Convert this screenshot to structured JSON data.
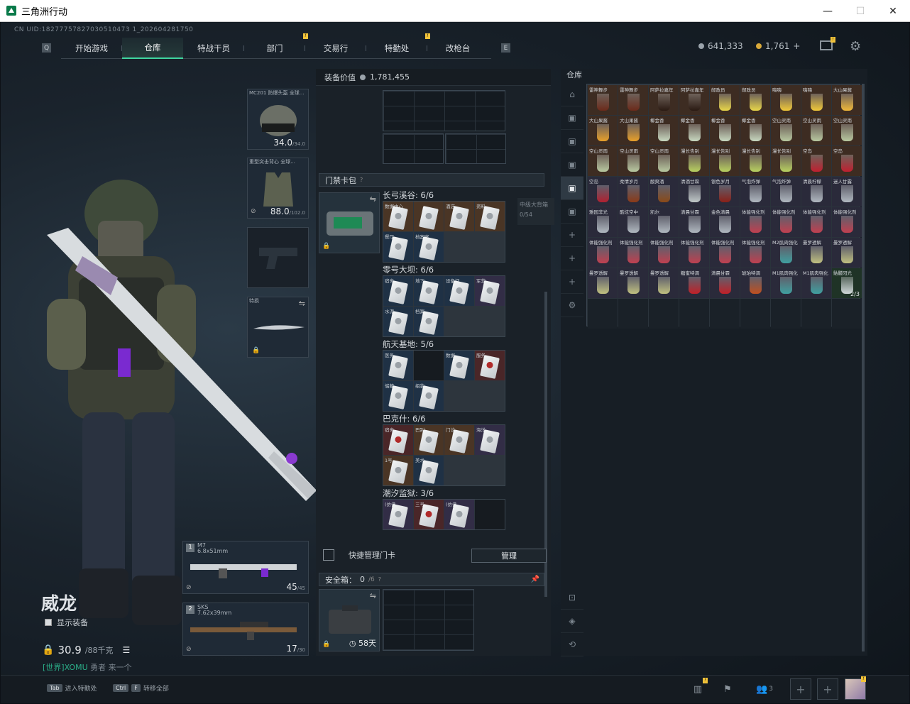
{
  "window": {
    "title": "三角洲行动",
    "minimize": "—",
    "maximize": "☐",
    "close": "✕"
  },
  "uid": "CN UID:18277757827030510473 1_202604281750",
  "nav": {
    "tabs": [
      {
        "label": "开始游戏"
      },
      {
        "label": "仓库"
      },
      {
        "label": "特战干员"
      },
      {
        "label": "部门"
      },
      {
        "label": "交易行"
      },
      {
        "label": "特勤处"
      },
      {
        "label": "改枪台"
      }
    ],
    "active": "仓库",
    "left_key": "Q",
    "right_key": "E",
    "badge": "!"
  },
  "currency": {
    "silver": "641,333",
    "gold": "1,761",
    "gold_plus": "+"
  },
  "operator": {
    "name": "威龙",
    "show_equipment": "显示装备",
    "weight": "30.9",
    "weight_max": "/88千克",
    "world_channel": "[世界]XOMU",
    "world_msg": "勇者 来一个"
  },
  "equip": {
    "helmet": {
      "label": "MC201 防爆头盔 全球...",
      "dur": "34.0",
      "max": "/34.0"
    },
    "armor": {
      "label": "重型突击背心 全球...",
      "dur": "88.0",
      "max": "/102.0"
    },
    "melee": {
      "label": "特损"
    },
    "weapon1": {
      "slot": "1",
      "name": "M7",
      "caliber": "6.8x51mm",
      "ammo": "45",
      "max": "/45"
    },
    "weapon2": {
      "slot": "2",
      "name": "SKS",
      "caliber": "7.62x39mm",
      "ammo": "17",
      "max": "/30"
    }
  },
  "middle": {
    "value_label": "装备价值",
    "value": "1,781,455",
    "keycard_title": "门禁卡包",
    "quick_manage": "快捷管理门卡",
    "manage_btn": "管理",
    "safebox": "安全箱：",
    "safebox_count": "0",
    "safebox_max": "/6",
    "safebox_days": "58天",
    "hint_q": "?",
    "tooltip": {
      "name": "中级大背箱",
      "cap": "0/54"
    },
    "groups": [
      {
        "title": "长弓溪谷: 6/6",
        "cards": [
          {
            "n": "数据中心",
            "c": "o"
          },
          {
            "n": "",
            "c": "o"
          },
          {
            "n": "酒店",
            "c": "o"
          },
          {
            "n": "资料",
            "c": "o"
          },
          {
            "n": "餐厅",
            "c": "b"
          },
          {
            "n": "档案室",
            "c": "b"
          }
        ]
      },
      {
        "title": "零号大坝: 6/6",
        "cards": [
          {
            "n": "宿舍",
            "c": "b"
          },
          {
            "n": "地下",
            "c": "b"
          },
          {
            "n": "设备间",
            "c": "b"
          },
          {
            "n": "军营",
            "c": "p"
          },
          {
            "n": "水泥",
            "c": "b"
          },
          {
            "n": "档案",
            "c": "b"
          }
        ]
      },
      {
        "title": "航天基地: 5/6",
        "cards": [
          {
            "n": "医务",
            "c": "b"
          },
          {
            "n": "",
            "c": "e"
          },
          {
            "n": "数据",
            "c": "b"
          },
          {
            "n": "服务",
            "c": "r"
          },
          {
            "n": "储藏",
            "c": "b"
          },
          {
            "n": "组装",
            "c": "b"
          }
        ]
      },
      {
        "title": "巴克什: 6/6",
        "cards": [
          {
            "n": "宿舍",
            "c": "r"
          },
          {
            "n": "巴别",
            "c": "o"
          },
          {
            "n": "门诊",
            "c": "o"
          },
          {
            "n": "海洋",
            "c": "p"
          },
          {
            "n": "1号",
            "c": "o"
          },
          {
            "n": "美术",
            "c": "b"
          }
        ]
      },
      {
        "title": "潮汐监狱: 3/6",
        "cards": [
          {
            "n": "(仿佛",
            "c": "p"
          },
          {
            "n": "三号",
            "c": "r"
          },
          {
            "n": "(仿佛",
            "c": "p"
          },
          {
            "n": "",
            "c": "e"
          }
        ]
      }
    ]
  },
  "stash": {
    "title": "仓库",
    "items": [
      {
        "n": "雷神舞步",
        "c": "o",
        "g": "#6b2a1a"
      },
      {
        "n": "雷神舞步",
        "c": "o",
        "g": "#6b2a1a"
      },
      {
        "n": "阿萨拉嘉年",
        "c": "o",
        "g": "#2a1a12"
      },
      {
        "n": "阿萨拉嘉年",
        "c": "o",
        "g": "#2a1a12"
      },
      {
        "n": "邮政员",
        "c": "o",
        "g": "#e8d64a"
      },
      {
        "n": "邮政员",
        "c": "o",
        "g": "#e8d64a"
      },
      {
        "n": "嗨嗨",
        "c": "o",
        "g": "#f0c83a"
      },
      {
        "n": "嗨嗨",
        "c": "o",
        "g": "#f0c83a"
      },
      {
        "n": "大山果酱",
        "c": "o",
        "g": "#f0b83a"
      },
      {
        "n": "大山果酱",
        "c": "o",
        "g": "#e8a02a"
      },
      {
        "n": "大山果酱",
        "c": "o",
        "g": "#e8a02a"
      },
      {
        "n": "椰金香",
        "c": "o",
        "g": "#c8d8c0"
      },
      {
        "n": "椰金香",
        "c": "o",
        "g": "#c8d8c0"
      },
      {
        "n": "椰金香",
        "c": "o",
        "g": "#c8d8c0"
      },
      {
        "n": "椰金香",
        "c": "o",
        "g": "#c8d8c0"
      },
      {
        "n": "空山灵雨",
        "c": "o",
        "g": "#b8c8a0"
      },
      {
        "n": "空山灵雨",
        "c": "o",
        "g": "#b8c8a0"
      },
      {
        "n": "空山灵雨",
        "c": "o",
        "g": "#b8c8a0"
      },
      {
        "n": "空山灵雨",
        "c": "o",
        "g": "#b8c8a0"
      },
      {
        "n": "空山灵雨",
        "c": "o",
        "g": "#b8c8a0"
      },
      {
        "n": "空山灵雨",
        "c": "o",
        "g": "#b8c8a0"
      },
      {
        "n": "漫长告别",
        "c": "o",
        "g": "#b8d060"
      },
      {
        "n": "漫长告别",
        "c": "o",
        "g": "#b8d060"
      },
      {
        "n": "漫长告别",
        "c": "o",
        "g": "#b8d060"
      },
      {
        "n": "漫长告别",
        "c": "o",
        "g": "#b8d060"
      },
      {
        "n": "空岛",
        "c": "o",
        "g": "#c02030"
      },
      {
        "n": "空岛",
        "c": "o",
        "g": "#c02030"
      },
      {
        "n": "空岛",
        "c": "p",
        "g": "#b02030"
      },
      {
        "n": "柔情岁月",
        "c": "p",
        "g": "#8a3a18"
      },
      {
        "n": "酸爽酒",
        "c": "p",
        "g": "#8a4a18"
      },
      {
        "n": "清酒甘霖",
        "c": "p",
        "g": "#c0c8c8"
      },
      {
        "n": "银色岁月",
        "c": "p",
        "g": "#8a2018"
      },
      {
        "n": "气泡炸弹",
        "c": "p",
        "g": "#b0b8c0"
      },
      {
        "n": "气泡炸弹",
        "c": "p",
        "g": "#b0b8c0"
      },
      {
        "n": "清晨柠檬",
        "c": "p",
        "g": "#b0b8c0"
      },
      {
        "n": "迷人甘露",
        "c": "p",
        "g": "#b0b8c0"
      },
      {
        "n": "雅园非光",
        "c": "p",
        "g": "#b0b8c0"
      },
      {
        "n": "酷炫空中",
        "c": "p",
        "g": "#b0b8c0"
      },
      {
        "n": "凯尔",
        "c": "p",
        "g": "#b0b8c0"
      },
      {
        "n": "清晨甘霖",
        "c": "p",
        "g": "#b0b8c0"
      },
      {
        "n": "金色清晨",
        "c": "p",
        "g": "#b0b8c0"
      },
      {
        "n": "体能强化剂",
        "c": "p",
        "g": "#c04050"
      },
      {
        "n": "体能强化剂",
        "c": "p",
        "g": "#c04050"
      },
      {
        "n": "体能强化剂",
        "c": "p",
        "g": "#c04050"
      },
      {
        "n": "体能强化剂",
        "c": "p",
        "g": "#c04050"
      },
      {
        "n": "体能强化剂",
        "c": "p",
        "g": "#c04050"
      },
      {
        "n": "体能强化剂",
        "c": "p",
        "g": "#c04050"
      },
      {
        "n": "体能强化剂",
        "c": "p",
        "g": "#c04050"
      },
      {
        "n": "体能强化剂",
        "c": "p",
        "g": "#c04050"
      },
      {
        "n": "体能强化剂",
        "c": "p",
        "g": "#c04050"
      },
      {
        "n": "体能强化剂",
        "c": "p",
        "g": "#c04050"
      },
      {
        "n": "M2肌肉强化",
        "c": "p",
        "g": "#40a0a0"
      },
      {
        "n": "曼罗透解",
        "c": "p",
        "g": "#c0c080"
      },
      {
        "n": "曼罗透解",
        "c": "p",
        "g": "#c0c080"
      },
      {
        "n": "曼罗透解",
        "c": "p",
        "g": "#c0c080"
      },
      {
        "n": "曼罗透解",
        "c": "p",
        "g": "#c0c080"
      },
      {
        "n": "曼罗透解",
        "c": "p",
        "g": "#c0c080"
      },
      {
        "n": "糖蜜特调",
        "c": "p",
        "g": "#c02028"
      },
      {
        "n": "清晨甘霖",
        "c": "p",
        "g": "#c02028"
      },
      {
        "n": "琥珀特调",
        "c": "p",
        "g": "#c05020"
      },
      {
        "n": "M1肌肉强化",
        "c": "p",
        "g": "#40a0a0"
      },
      {
        "n": "M1肌肉强化",
        "c": "p",
        "g": "#40a0a0"
      },
      {
        "n": "骷髅阳光",
        "c": "gr",
        "g": "#d0d8d8",
        "cnt": "2/3"
      }
    ]
  },
  "bottom": {
    "tab_key": "Tab",
    "tab_hint": "进入特勤处",
    "ctrl_key": "Ctrl",
    "f_key": "F",
    "ctrl_hint": "转移全部",
    "friends": "3"
  }
}
